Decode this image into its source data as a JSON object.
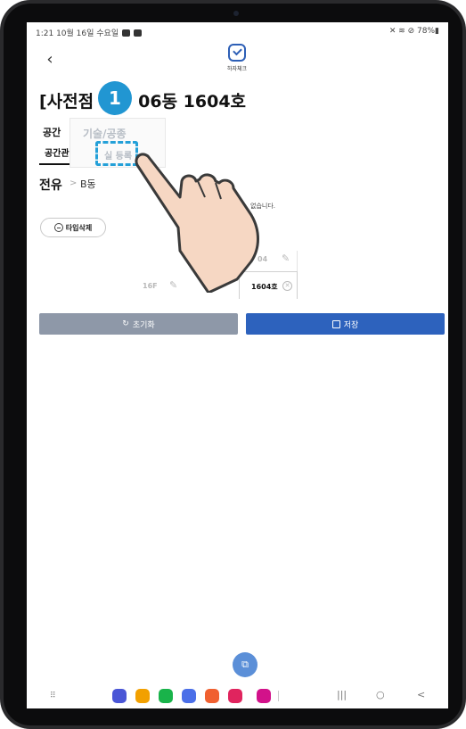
{
  "status_bar": {
    "time_date": "1:21  10월 16일 수요일",
    "right": "78%"
  },
  "header": {
    "app_label": "하자체크",
    "title": "[사전점검] 106동 1604호",
    "title_visible_left": "[사전점",
    "title_visible_right": "06동 1604호"
  },
  "space_section": {
    "label": "공간",
    "active_tab": "공간관리",
    "dropdown_options": [
      "기술/공종",
      "실 등록"
    ]
  },
  "step_badge": "1",
  "breadcrumb": {
    "section": "전유",
    "separator": ">",
    "building": "B동"
  },
  "empty_note": "없습니다.",
  "type_delete_label": "타입삭제",
  "grid": {
    "column_header": "04",
    "floor_label": "16F",
    "unit": "1604호"
  },
  "buttons": {
    "reset": "초기화",
    "save": "저장"
  },
  "nav_bar": {
    "recent": "|||",
    "home": "○",
    "back": "<"
  },
  "colors": {
    "primary": "#2d62bd",
    "reset_button": "#8e98a8",
    "highlight": "#24a0d8",
    "app_icons": [
      "#4a56d6",
      "#f2a000",
      "#19b34a",
      "#4b6fe8",
      "#f06030",
      "#e0245e",
      "#d2128a"
    ]
  }
}
